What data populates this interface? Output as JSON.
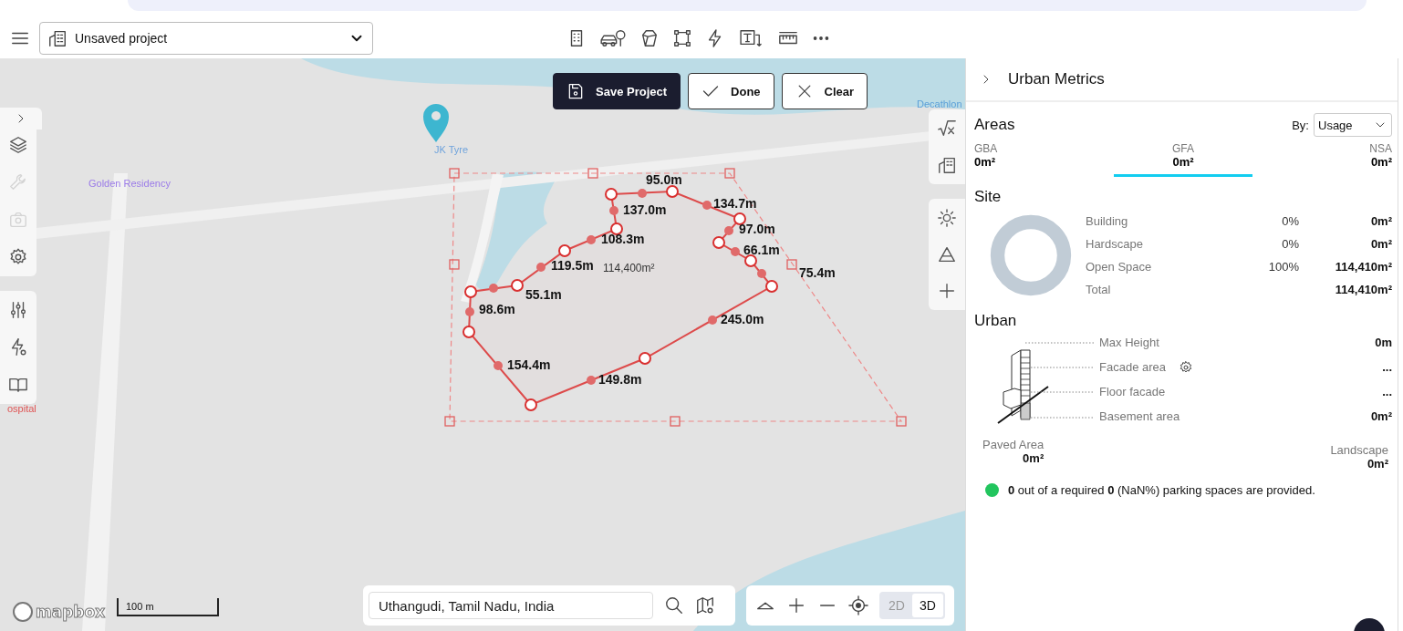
{
  "toolbar": {
    "project_name": "Unsaved project"
  },
  "map": {
    "actions": [
      {
        "kind": "save",
        "label": "Save Project"
      },
      {
        "kind": "done",
        "label": "Done"
      },
      {
        "kind": "clear",
        "label": "Clear"
      }
    ],
    "place_labels": [
      {
        "text": "Golden Residency",
        "color": "#9b7be8"
      },
      {
        "text": "JK Tyre",
        "color": "#6fa3dc"
      },
      {
        "text": "Decathlon",
        "color": "#5a9fd8"
      },
      {
        "text": "ospital",
        "color": "#e05555"
      }
    ],
    "edge_labels": [
      "95.0m",
      "137.0m",
      "134.7m",
      "108.3m",
      "97.0m",
      "66.1m",
      "119.5m",
      "75.4m",
      "55.1m",
      "98.6m",
      "245.0m",
      "154.4m",
      "149.8m"
    ],
    "area_label": "114,400m²",
    "left_tool_groups": [
      {
        "tools": [
          {
            "kind": "layers",
            "disabled": false
          },
          {
            "kind": "wrench",
            "disabled": true
          },
          {
            "kind": "camera",
            "disabled": true
          },
          {
            "kind": "settings",
            "disabled": false
          }
        ]
      },
      {
        "tools": [
          {
            "kind": "sliders",
            "disabled": false
          },
          {
            "kind": "energy",
            "disabled": false
          },
          {
            "kind": "book",
            "disabled": false
          }
        ]
      }
    ],
    "logo": "mapbox",
    "scale": "100 m",
    "search": {
      "value": "Uthangudi, Tamil Nadu, India"
    },
    "view_modes": [
      {
        "label": "2D",
        "selected": false
      },
      {
        "label": "3D",
        "selected": true
      }
    ]
  },
  "panel": {
    "title": "Urban Metrics",
    "areas": {
      "title": "Areas",
      "by_label": "By:",
      "by_value": "Usage",
      "tabs": [
        {
          "label": "GBA",
          "value": "0m²",
          "selected": false
        },
        {
          "label": "GFA",
          "value": "0m²",
          "selected": true
        },
        {
          "label": "NSA",
          "value": "0m²",
          "selected": false
        }
      ]
    },
    "site": {
      "title": "Site",
      "rows": [
        {
          "label": "Building",
          "percent": "0%",
          "value": "0m²"
        },
        {
          "label": "Hardscape",
          "percent": "0%",
          "value": "0m²"
        },
        {
          "label": "Open Space",
          "percent": "100%",
          "value": "114,410m²"
        },
        {
          "label": "Total",
          "value": "114,410m²"
        }
      ]
    },
    "urban": {
      "title": "Urban",
      "rows": [
        {
          "label": "Max Height",
          "value": "0m",
          "settings": false
        },
        {
          "label": "Facade area",
          "value": "...",
          "settings": true
        },
        {
          "label": "Floor facade",
          "value": "...",
          "settings": false
        },
        {
          "label": "Basement area",
          "value": "0m²",
          "settings": false
        }
      ],
      "paved": {
        "label": "Paved Area",
        "value": "0m²"
      },
      "landscape": {
        "label": "Landscape",
        "value": "0m²"
      }
    },
    "parking": {
      "color": "#22c55e",
      "text": "**0** out of a required **0** (NaN%) parking spaces are provided."
    }
  }
}
